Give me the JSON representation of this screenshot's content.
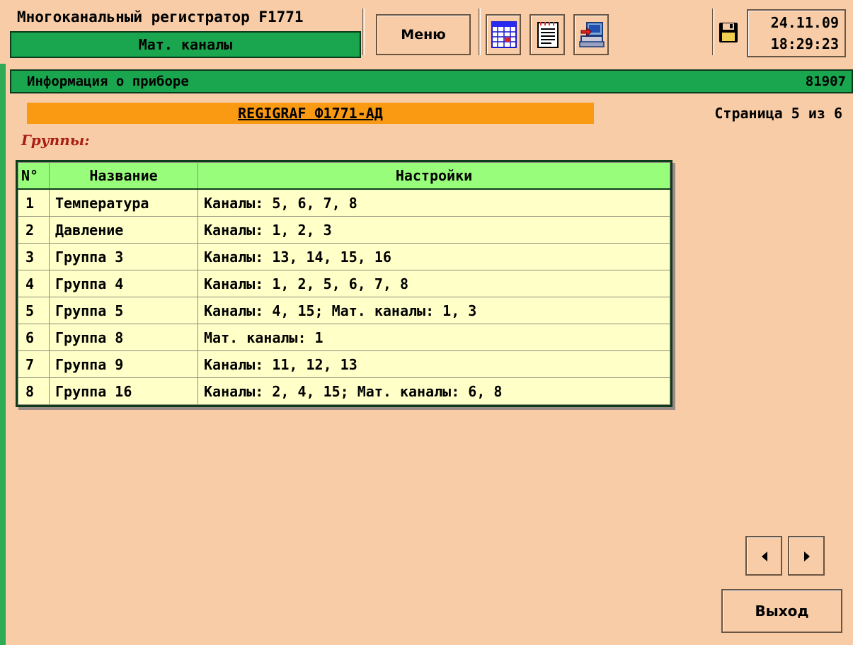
{
  "header": {
    "app_title": "Многоканальный регистратор F1771",
    "mode": "Мат. каналы",
    "menu_label": "Меню",
    "date": "24.11.09",
    "time": "18:29:23"
  },
  "info": {
    "title": "Информация о приборе",
    "serial": "81907",
    "device_name": "REGIGRAF Ф1771-АД",
    "page_indicator": "Страница 5 из 6",
    "section_label": "Группы:"
  },
  "table": {
    "headers": [
      "N°",
      "Название",
      "Настройки"
    ],
    "rows": [
      {
        "num": "1",
        "name": "Температура",
        "settings": "Каналы: 5, 6, 7, 8"
      },
      {
        "num": "2",
        "name": "Давление",
        "settings": "Каналы: 1, 2, 3"
      },
      {
        "num": "3",
        "name": "Группа 3",
        "settings": "Каналы: 13, 14, 15, 16"
      },
      {
        "num": "4",
        "name": "Группа 4",
        "settings": "Каналы: 1, 2, 5, 6, 7, 8"
      },
      {
        "num": "5",
        "name": "Группа 5",
        "settings": "Каналы: 4, 15; Мат. каналы: 1, 3"
      },
      {
        "num": "6",
        "name": "Группа 8",
        "settings": "Мат. каналы: 1"
      },
      {
        "num": "7",
        "name": "Группа 9",
        "settings": "Каналы: 11, 12, 13"
      },
      {
        "num": "8",
        "name": "Группа 16",
        "settings": "Каналы: 2, 4, 15; Мат. каналы: 6, 8"
      }
    ]
  },
  "footer": {
    "exit_label": "Выход"
  },
  "icons": {
    "table_view": "grid-table-icon",
    "report": "notepad-icon",
    "export": "computer-export-icon",
    "storage": "floppy-disk-icon",
    "prev": "arrow-left-icon",
    "next": "arrow-right-icon"
  },
  "colors": {
    "background": "#f8cca6",
    "header_green": "#19a64e",
    "banner_orange": "#fa9a12",
    "table_header": "#98fd7a",
    "table_body": "#ffffc8",
    "section_label": "#aa1d12"
  }
}
